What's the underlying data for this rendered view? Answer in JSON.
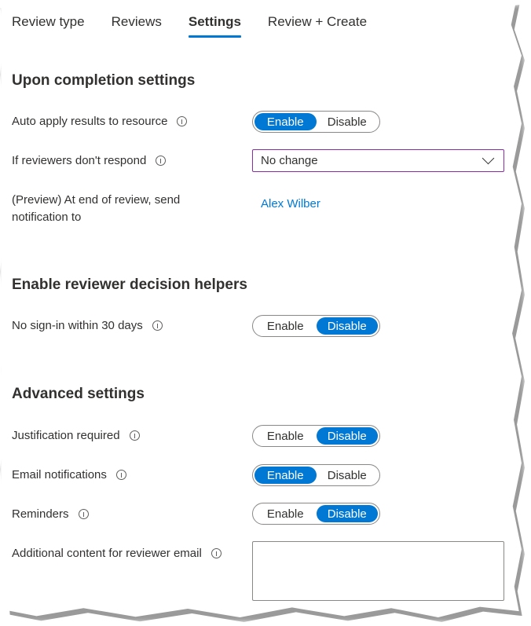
{
  "tabs": [
    {
      "label": "Review type",
      "active": false
    },
    {
      "label": "Reviews",
      "active": false
    },
    {
      "label": "Settings",
      "active": true
    },
    {
      "label": "Review + Create",
      "active": false
    }
  ],
  "colors": {
    "accent": "#0078d4",
    "dropdown_focus_border": "#8a2da6",
    "text": "#323130"
  },
  "sections": {
    "completion": {
      "title": "Upon completion settings",
      "auto_apply": {
        "label": "Auto apply results to resource",
        "options": [
          "Enable",
          "Disable"
        ],
        "selected": "Enable"
      },
      "no_response": {
        "label": "If reviewers don't respond",
        "value": "No change"
      },
      "notify": {
        "label": "(Preview) At end of review, send notification to",
        "value": "Alex Wilber"
      }
    },
    "helpers": {
      "title": "Enable reviewer decision helpers",
      "no_signin": {
        "label": "No sign-in within 30 days",
        "options": [
          "Enable",
          "Disable"
        ],
        "selected": "Disable"
      }
    },
    "advanced": {
      "title": "Advanced settings",
      "justification": {
        "label": "Justification required",
        "options": [
          "Enable",
          "Disable"
        ],
        "selected": "Disable"
      },
      "email": {
        "label": "Email notifications",
        "options": [
          "Enable",
          "Disable"
        ],
        "selected": "Enable"
      },
      "reminders": {
        "label": "Reminders",
        "options": [
          "Enable",
          "Disable"
        ],
        "selected": "Disable"
      },
      "additional_content": {
        "label": "Additional content for reviewer email",
        "value": ""
      }
    }
  }
}
